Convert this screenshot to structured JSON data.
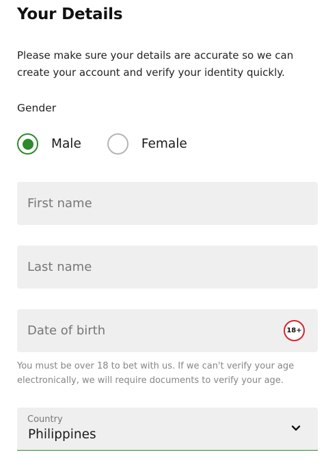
{
  "header": {
    "title": "Your Details"
  },
  "intro": "Please make sure your details are accurate so we can create your account and verify your identity quickly.",
  "gender": {
    "label": "Gender",
    "options": [
      {
        "label": "Male",
        "selected": true
      },
      {
        "label": "Female",
        "selected": false
      }
    ]
  },
  "fields": {
    "first_name": {
      "placeholder": "First name",
      "value": ""
    },
    "last_name": {
      "placeholder": "Last name",
      "value": ""
    },
    "dob": {
      "placeholder": "Date of birth",
      "value": "",
      "badge": "18+"
    }
  },
  "age_note": "You must be over 18 to bet with us. If we can't verify your age electronically, we will require documents to verify your age.",
  "country": {
    "label": "Country",
    "value": "Philippines",
    "icon": "chevron-down-icon"
  },
  "colors": {
    "accent_green": "#2d8a2d",
    "badge_red": "#d8232a",
    "field_bg": "#efefef"
  }
}
